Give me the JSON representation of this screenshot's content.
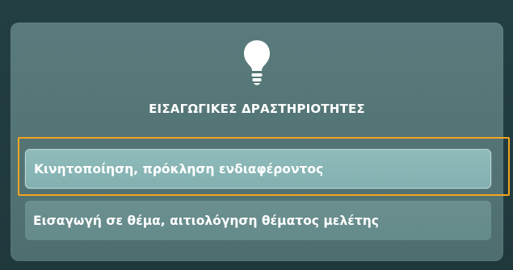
{
  "section": {
    "icon": "lightbulb-icon",
    "title": "ΕΙΣΑΓΩΓΙΚΕΣ ΔΡΑΣΤΗΡΙΟΤΗΤΕΣ",
    "options": [
      {
        "label": "Κινητοποίηση, πρόκληση ενδιαφέροντος",
        "selected": true
      },
      {
        "label": "Εισαγωγή σε θέμα, αιτιολόγηση θέματος μελέτης",
        "selected": false
      }
    ]
  },
  "colors": {
    "highlight": "#f2a51e",
    "panel": "#557676",
    "selected_option": "#8fbcbb",
    "option": "#6b8f8f"
  }
}
